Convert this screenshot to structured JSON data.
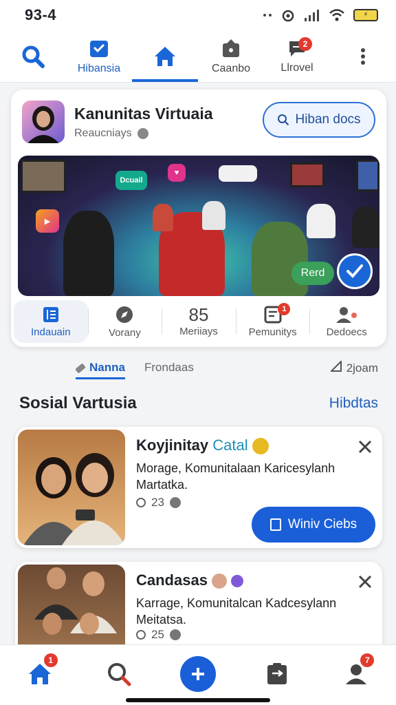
{
  "status_bar": {
    "time": "93-4"
  },
  "top_tabs": [
    {
      "label": "Hibansia"
    },
    {
      "label": ""
    },
    {
      "label": "Caanbo"
    },
    {
      "label": "Llrovel",
      "badge": "2"
    },
    {
      "label": ""
    }
  ],
  "community": {
    "title": "Kanunitas Virtuaia",
    "subtitle": "Reaucniays",
    "button_label": "Hiban docs",
    "hero": {
      "sticker_1": "Dcuail",
      "rate_label": "Rerd"
    },
    "stats": [
      {
        "label": "Indauain"
      },
      {
        "label": "Vorany"
      },
      {
        "number": "85",
        "label": "Meriiays"
      },
      {
        "label": "Pemunitys",
        "badge": "1"
      },
      {
        "label": "Dedoecs"
      }
    ]
  },
  "filters": {
    "active": "Nanna",
    "second": "Frondaas",
    "time": "2joam"
  },
  "section": {
    "title": "Sosial Vartusia",
    "link": "Hibdtas"
  },
  "posts": [
    {
      "title": "Koyjinitay",
      "tag": "Catal",
      "description": "Morage, Komunitalaan Karicesylanh Martatka.",
      "count": "23",
      "button_label": "Winiv Ciebs"
    },
    {
      "title": "Candasas",
      "description": "Karrage, Komunitalcan Kadcesylann Meitatsa.",
      "count": "25"
    }
  ],
  "bottom_nav": {
    "home_badge": "1",
    "profile_badge": "7"
  },
  "colors": {
    "accent": "#1a66d6",
    "badge": "#e23b2e",
    "rating": "#3aa05a"
  }
}
